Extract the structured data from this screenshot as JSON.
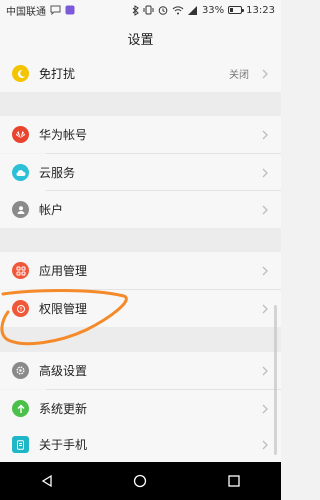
{
  "status_bar": {
    "carrier": "中国联通",
    "battery_percent": "33%",
    "time": "13:23",
    "icons": [
      "chat-icon",
      "app-icon",
      "bluetooth-icon",
      "vibrate-icon",
      "alarm-icon",
      "wifi-icon",
      "signal-icon",
      "battery-icon"
    ]
  },
  "title": "设置",
  "groups": [
    {
      "items": [
        {
          "label": "免打扰",
          "value": "关闭",
          "icon": "moon-icon",
          "color": "#f5c400"
        }
      ]
    },
    {
      "items": [
        {
          "label": "华为帐号",
          "icon": "huawei-icon",
          "color": "#e8442e"
        },
        {
          "label": "云服务",
          "icon": "cloud-icon",
          "color": "#2cc0d6"
        },
        {
          "label": "帐户",
          "icon": "person-icon",
          "color": "#8a8a8a"
        }
      ]
    },
    {
      "items": [
        {
          "label": "应用管理",
          "icon": "apps-icon",
          "color": "#f0583a"
        },
        {
          "label": "权限管理",
          "icon": "permission-icon",
          "color": "#f0583a"
        }
      ]
    },
    {
      "items": [
        {
          "label": "高级设置",
          "icon": "gear-icon",
          "color": "#8a8a8a"
        },
        {
          "label": "系统更新",
          "icon": "update-icon",
          "color": "#4cc04a"
        },
        {
          "label": "关于手机",
          "icon": "phone-info-icon",
          "color": "#1fb6c7"
        }
      ]
    }
  ],
  "nav_bar": {
    "buttons": [
      "back-icon",
      "home-icon",
      "recent-apps-icon"
    ]
  },
  "colors": {
    "accent_annotation": "#f48a2a"
  }
}
